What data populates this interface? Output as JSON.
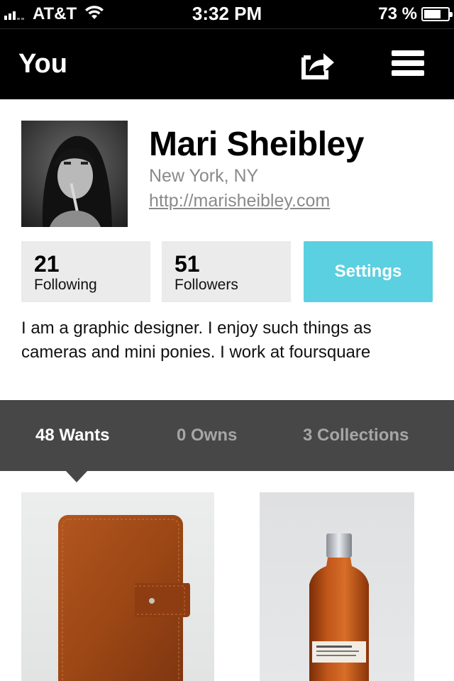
{
  "status_bar": {
    "carrier": "AT&T",
    "time": "3:32 PM",
    "battery_percent": "73 %",
    "battery_level": 0.73,
    "signal_bars": 3
  },
  "nav": {
    "title": "You",
    "share_icon": "share-icon",
    "menu_icon": "menu-icon"
  },
  "profile": {
    "name": "Mari Sheibley",
    "location": "New York, NY",
    "url": "http://marisheibley.com",
    "bio": "I am a graphic designer. I enjoy such things as cameras and mini ponies. I work at foursquare"
  },
  "stats": [
    {
      "count": "21",
      "label": "Following"
    },
    {
      "count": "51",
      "label": "Followers"
    }
  ],
  "settings_label": "Settings",
  "tabs": [
    {
      "label": "48 Wants",
      "active": true
    },
    {
      "label": "0 Owns",
      "active": false
    },
    {
      "label": "3 Collections",
      "active": false
    }
  ],
  "colors": {
    "settings_button": "#5bd0e0",
    "tab_bar": "#474747",
    "stat_box": "#ebebeb"
  },
  "items": [
    {
      "icon": "leather-notebook-image"
    },
    {
      "icon": "whiskey-bottle-image"
    }
  ]
}
